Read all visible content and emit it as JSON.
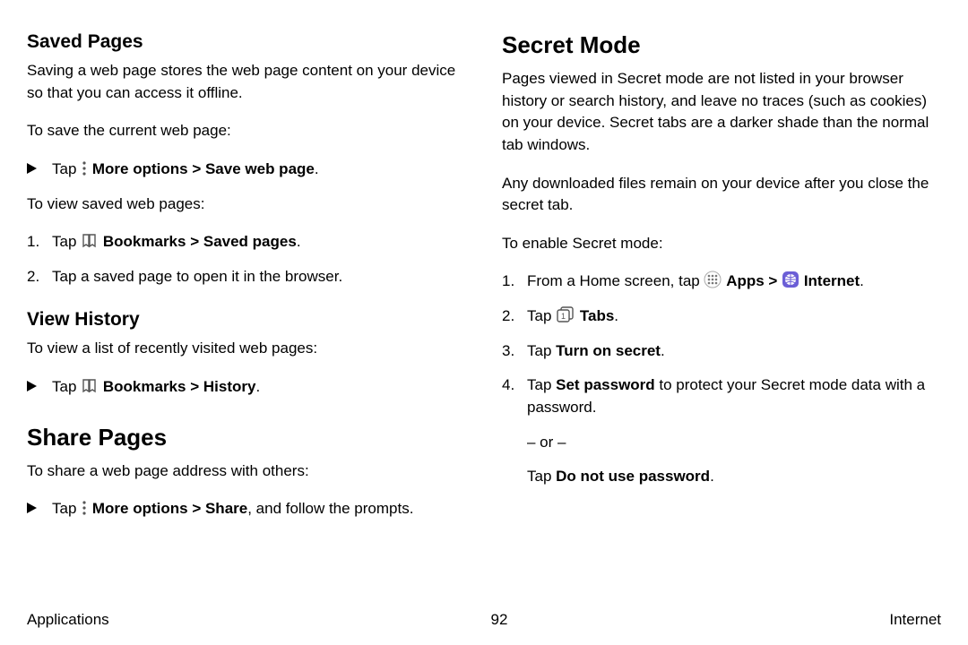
{
  "left": {
    "saved_pages_h": "Saved Pages",
    "saved_pages_p": "Saving a web page stores the web page content on your device so that you can access it offline.",
    "to_save": "To save the current web page:",
    "tap1_pre": "Tap ",
    "more_options": "More options",
    "gt": " > ",
    "save_web_page": "Save web page",
    "period": ".",
    "to_view_saved": "To view saved web pages:",
    "step1_num": "1.",
    "step1_pre": "Tap ",
    "bookmarks": "Bookmarks",
    "saved_pages_link": "Saved pages",
    "step2_num": "2.",
    "step2_text": "Tap a saved page to open it in the browser.",
    "view_history_h": "View History",
    "view_history_p": "To view a list of recently visited web pages:",
    "history": "History",
    "share_pages_h": "Share Pages",
    "share_pages_p": "To share a web page address with others:",
    "share": "Share",
    "share_suffix": ", and follow the prompts."
  },
  "right": {
    "secret_h": "Secret Mode",
    "secret_p1": "Pages viewed in Secret mode are not listed in your browser history or search history, and leave no traces (such as cookies) on your device. Secret tabs are a darker shade than the normal tab windows.",
    "secret_p2": "Any downloaded files remain on your device after you close the secret tab.",
    "to_enable": "To enable Secret mode:",
    "s1_num": "1.",
    "s1_pre": "From a Home screen, tap ",
    "apps": "Apps",
    "internet": "Internet",
    "s2_num": "2.",
    "s2_pre": "Tap ",
    "tabs": "Tabs",
    "s3_num": "3.",
    "s3_pre": "Tap ",
    "turn_on": "Turn on secret",
    "s4_num": "4.",
    "s4_pre": "Tap ",
    "set_password": "Set password",
    "s4_suffix": " to protect your Secret mode data with a password.",
    "or": "– or –",
    "dnup_pre": "Tap ",
    "dnup": "Do not use password"
  },
  "footer": {
    "left": "Applications",
    "center": "92",
    "right": "Internet"
  }
}
